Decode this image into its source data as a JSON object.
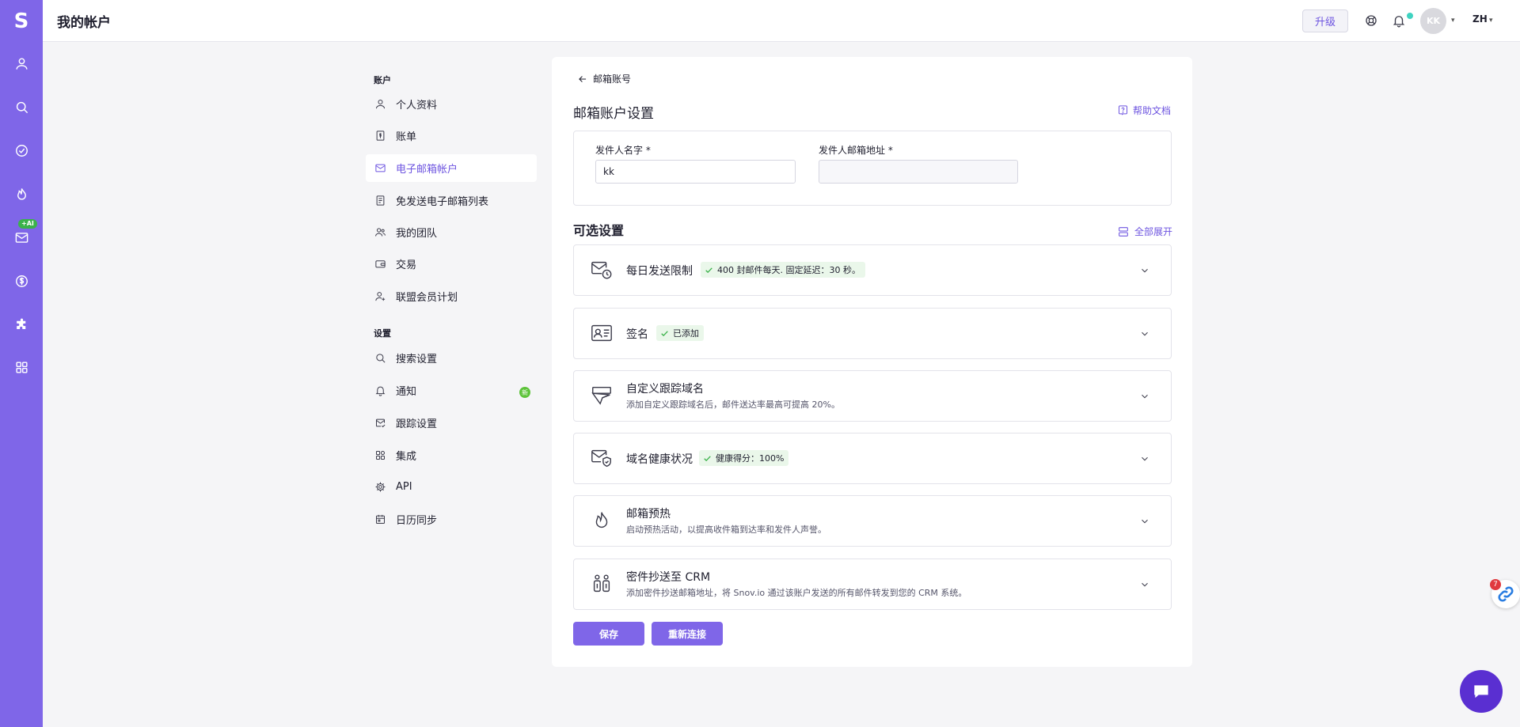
{
  "app": {
    "logo_letter": "S"
  },
  "header": {
    "title": "我的帐户",
    "upgrade_label": "升级",
    "avatar_initials": "KK",
    "language": "ZH"
  },
  "sidebar": {
    "account_section": "账户",
    "account_items": [
      {
        "label": "个人资料",
        "icon": "user-icon"
      },
      {
        "label": "账单",
        "icon": "dollar-doc-icon"
      },
      {
        "label": "电子邮箱帐户",
        "icon": "mail-icon",
        "active": true
      },
      {
        "label": "免发送电子邮箱列表",
        "icon": "list-doc-icon"
      },
      {
        "label": "我的团队",
        "icon": "team-icon"
      },
      {
        "label": "交易",
        "icon": "wallet-icon"
      },
      {
        "label": "联盟会员计划",
        "icon": "user-plus-icon"
      }
    ],
    "settings_section": "设置",
    "settings_items": [
      {
        "label": "搜索设置",
        "icon": "search-icon"
      },
      {
        "label": "通知",
        "icon": "bell-icon",
        "badge": "新"
      },
      {
        "label": "跟踪设置",
        "icon": "mail-check-icon"
      },
      {
        "label": "集成",
        "icon": "grid-icon"
      },
      {
        "label": "API",
        "icon": "gear-icon"
      },
      {
        "label": "日历同步",
        "icon": "calendar-icon"
      }
    ]
  },
  "rail": {
    "ai_badge": "+AI",
    "items": [
      "profile-icon",
      "search-icon",
      "check-circle-icon",
      "flame-icon",
      "mail-icon",
      "dollar-circle-icon",
      "puzzle-icon",
      "apps-icon"
    ]
  },
  "main": {
    "back_label": "邮箱账号",
    "title": "邮箱账户设置",
    "help_label": "帮助文档",
    "sender_name_label": "发件人名字 *",
    "sender_name_value": "kk",
    "sender_email_label": "发件人邮箱地址 *",
    "sender_email_value": "",
    "optional_title": "可选设置",
    "expand_all_label": "全部展开",
    "panels": [
      {
        "title": "每日发送限制",
        "tag": "400 封邮件每天. 固定延迟：30 秒。",
        "subtitle": ""
      },
      {
        "title": "签名",
        "tag": "已添加",
        "subtitle": ""
      },
      {
        "title": "自定义跟踪域名",
        "tag": "",
        "subtitle": "添加自定义跟踪域名后，邮件送达率最高可提高 20%。"
      },
      {
        "title": "域名健康状况",
        "tag": "健康得分：100%",
        "subtitle": ""
      },
      {
        "title": "邮箱预热",
        "tag": "",
        "subtitle": "启动预热活动，以提高收件箱到达率和发件人声誉。"
      },
      {
        "title": "密件抄送至 CRM",
        "tag": "",
        "subtitle": "添加密件抄送邮箱地址，将 Snov.io 通过该账户发送的所有邮件转发到您的 CRM 系统。"
      }
    ],
    "save_label": "保存",
    "reconnect_label": "重新连接"
  },
  "widgets": {
    "notification_count": "7"
  },
  "colors": {
    "accent": "#7f66e8",
    "link": "#6e55e0",
    "success": "#3bb24a",
    "chat": "#5a2fd1"
  }
}
